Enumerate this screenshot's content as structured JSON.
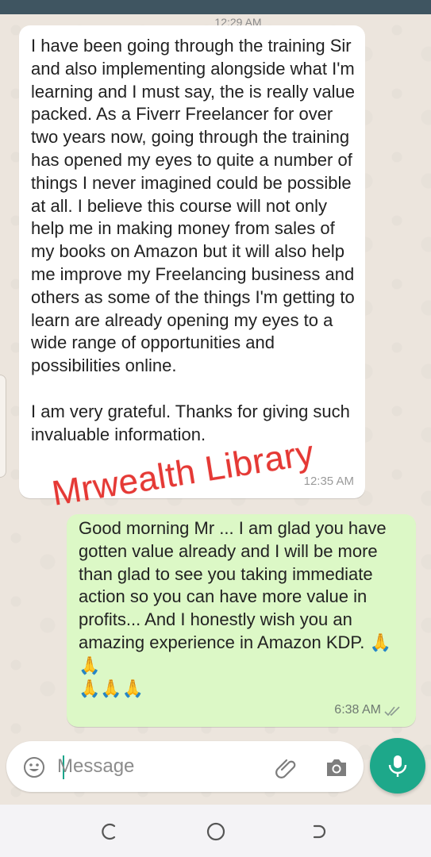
{
  "chat": {
    "day_chip": "12:29 AM",
    "incoming": {
      "text": "I have been going through the training Sir and also implementing alongside what I'm learning and I must say, the is really value packed. As a Fiverr Freelancer for over two years now, going through the training has opened my eyes to quite a number of things I never imagined could be possible at all. I believe this course will not only help me in making money from sales of my books on Amazon but it will also help me improve my Freelancing business and others as some of the things I'm getting to learn are already opening my eyes to a wide range of opportunities and possibilities online.\n\nI am very grateful. Thanks for giving such invaluable information.",
      "time": "12:35 AM"
    },
    "outgoing": {
      "text": "Good morning Mr ... I am glad you have gotten value already and I will be more than glad to see you taking immediate action so you can have more value in profits... And I honestly wish you an amazing experience in Amazon KDP. 🙏🙏\n🙏🙏🙏",
      "time": "6:38 AM",
      "status_icon": "double-check-icon"
    },
    "watermark": "Mrwealth Library"
  },
  "composer": {
    "placeholder": "Message",
    "icons": [
      "emoji-icon",
      "attach-icon",
      "camera-icon",
      "mic-icon"
    ]
  },
  "colors": {
    "accent": "#1da88a",
    "outgoing_bubble": "#dcf8c6",
    "watermark": "#e53935"
  }
}
